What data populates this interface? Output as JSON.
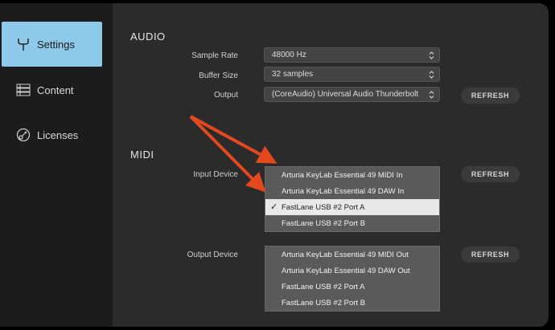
{
  "sidebar": {
    "items": [
      {
        "label": "Settings",
        "icon": "tuning-fork-icon",
        "active": true
      },
      {
        "label": "Content",
        "icon": "list-icon"
      },
      {
        "label": "Licenses",
        "icon": "key-icon"
      }
    ]
  },
  "audio": {
    "title": "AUDIO",
    "sample_rate": {
      "label": "Sample Rate",
      "value": "48000 Hz"
    },
    "buffer_size": {
      "label": "Buffer Size",
      "value": "32 samples"
    },
    "output": {
      "label": "Output",
      "value": "(CoreAudio) Universal Audio Thunderbolt"
    },
    "refresh_label": "REFRESH"
  },
  "midi": {
    "title": "MIDI",
    "input": {
      "label": "Input Device",
      "refresh_label": "REFRESH",
      "items": [
        "Arturia KeyLab Essential 49 MIDI In",
        "Arturia KeyLab Essential 49 DAW In",
        "FastLane USB #2 Port A",
        "FastLane USB #2 Port B"
      ],
      "selected": "FastLane USB #2 Port A",
      "check_glyph": "✓"
    },
    "output": {
      "label": "Output Device",
      "refresh_label": "REFRESH",
      "items": [
        "Arturia KeyLab Essential 49 MIDI Out",
        "Arturia KeyLab Essential 49 DAW Out",
        "FastLane USB #2 Port A",
        "FastLane USB #2 Port B"
      ]
    }
  },
  "colors": {
    "accent": "#8ec9ea",
    "annotation_arrow": "#e4481e"
  }
}
